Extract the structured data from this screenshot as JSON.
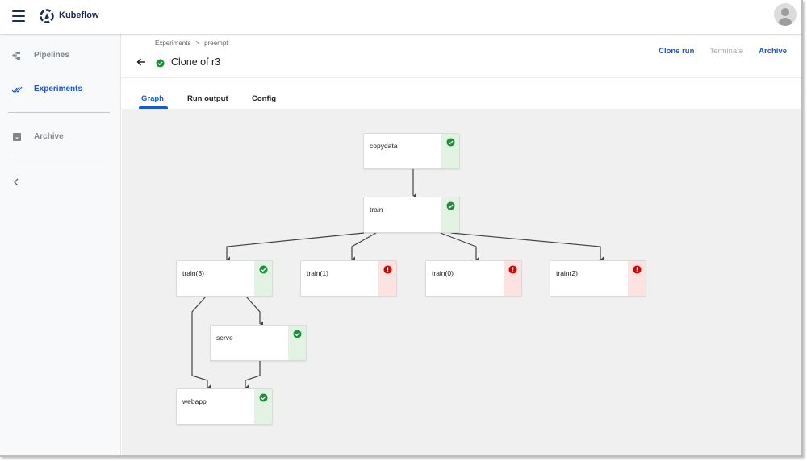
{
  "app": {
    "brand": "Kubeflow",
    "menu_icon": "hamburger-menu-icon",
    "logo_icon": "kubeflow-logo-icon",
    "avatar_icon": "user-avatar-icon"
  },
  "sidebar": {
    "items": [
      {
        "label": "Pipelines",
        "icon": "pipelines-icon",
        "active": false
      },
      {
        "label": "Experiments",
        "icon": "experiments-icon",
        "active": true
      },
      {
        "label": "Archive",
        "icon": "archive-icon",
        "active": false
      }
    ],
    "collapse_icon": "chevron-left-icon"
  },
  "header": {
    "breadcrumb": [
      "Experiments",
      "preempt"
    ],
    "breadcrumb_separator": ">",
    "title": "Clone of r3",
    "title_status": "succeeded",
    "actions": [
      {
        "label": "Clone run",
        "enabled": true
      },
      {
        "label": "Terminate",
        "enabled": false
      },
      {
        "label": "Archive",
        "enabled": true
      }
    ]
  },
  "tabs": [
    {
      "label": "Graph",
      "active": true
    },
    {
      "label": "Run output",
      "active": false
    },
    {
      "label": "Config",
      "active": false
    }
  ],
  "colors": {
    "accent": "#1a56db",
    "success": "#1e8e3e",
    "error": "#d50000",
    "success_bg": "#e2f2e3",
    "error_bg": "#fde2e2",
    "canvas_bg": "#f0f0f0"
  },
  "graph": {
    "nodes": [
      {
        "id": "copydata",
        "label": "copydata",
        "status": "succeeded"
      },
      {
        "id": "train",
        "label": "train",
        "status": "succeeded"
      },
      {
        "id": "train3",
        "label": "train(3)",
        "status": "succeeded"
      },
      {
        "id": "train1",
        "label": "train(1)",
        "status": "failed"
      },
      {
        "id": "train0",
        "label": "train(0)",
        "status": "failed"
      },
      {
        "id": "train2",
        "label": "train(2)",
        "status": "failed"
      },
      {
        "id": "serve",
        "label": "serve",
        "status": "succeeded"
      },
      {
        "id": "webapp",
        "label": "webapp",
        "status": "succeeded"
      }
    ],
    "edges": [
      [
        "copydata",
        "train"
      ],
      [
        "train",
        "train3"
      ],
      [
        "train",
        "train1"
      ],
      [
        "train",
        "train0"
      ],
      [
        "train",
        "train2"
      ],
      [
        "train3",
        "serve"
      ],
      [
        "train3",
        "webapp"
      ],
      [
        "serve",
        "webapp"
      ]
    ]
  }
}
